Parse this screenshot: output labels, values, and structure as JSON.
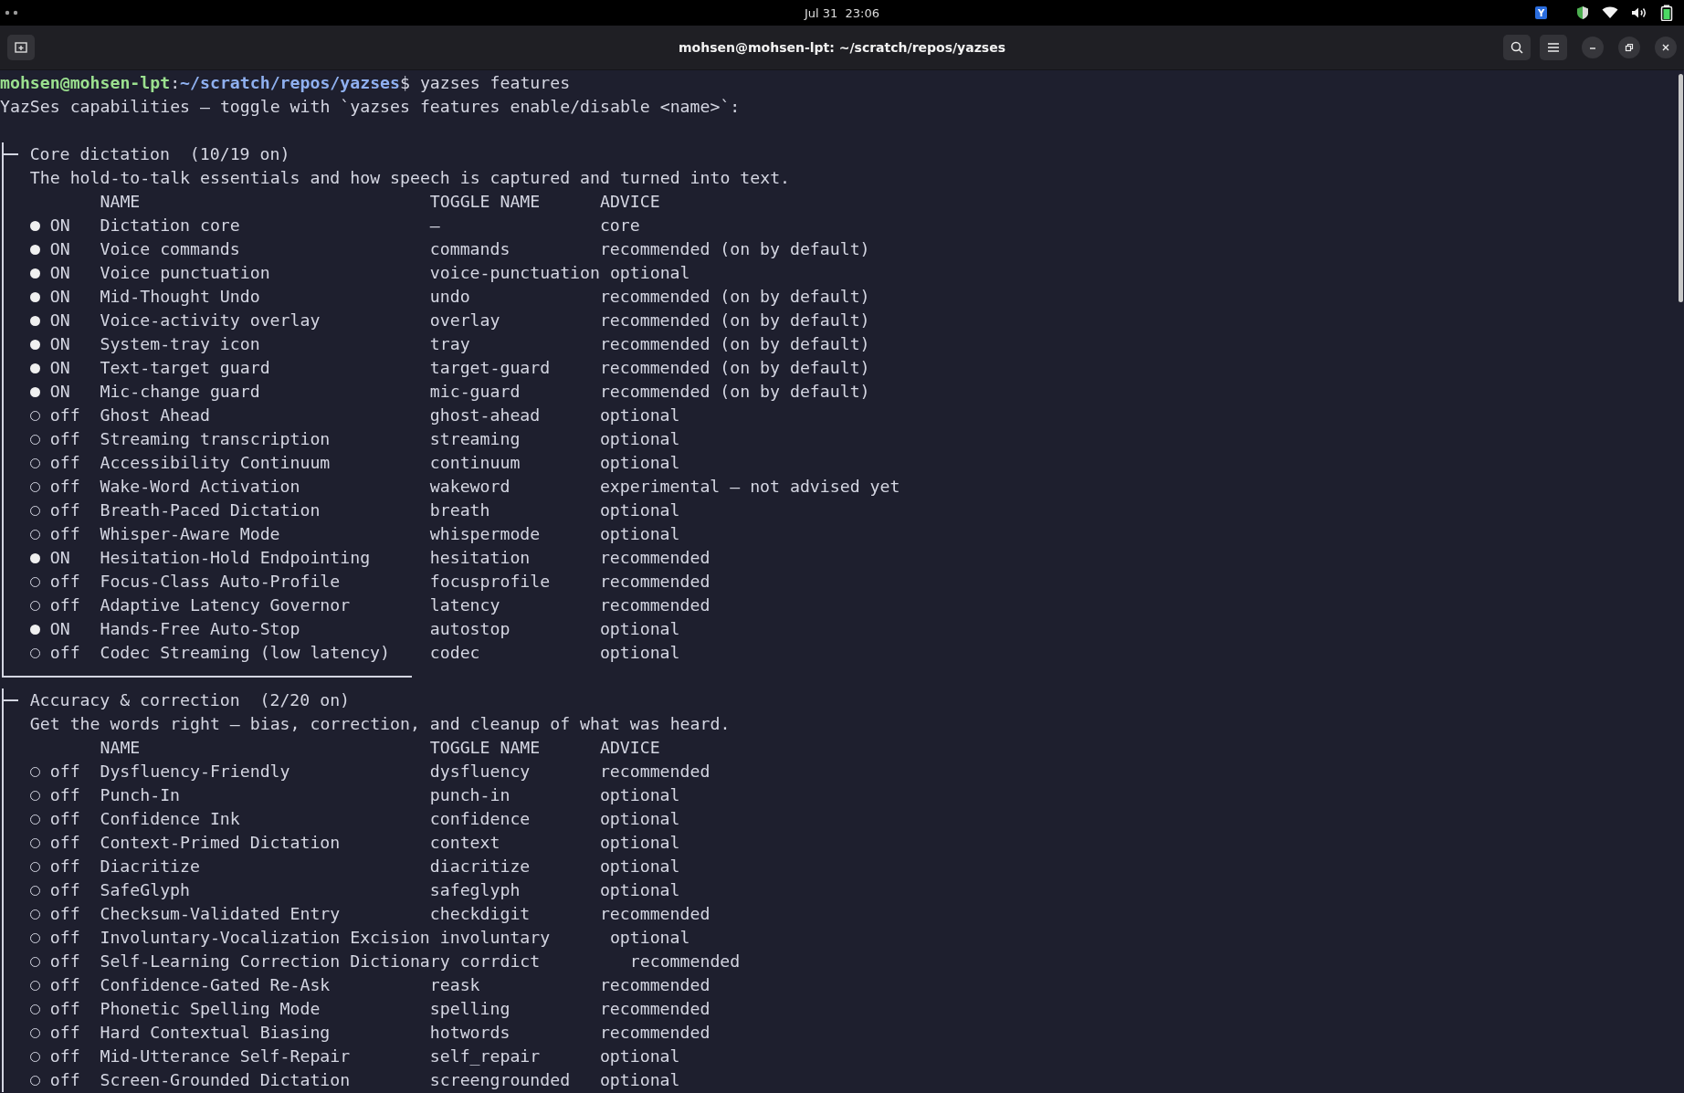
{
  "topbar": {
    "clock": "Jul 31  23:06",
    "tray_app_label": "Y"
  },
  "window": {
    "title": "mohsen@mohsen-lpt: ~/scratch/repos/yazses"
  },
  "terminal": {
    "prompt": {
      "user_host": "mohsen@mohsen-lpt",
      "separator": ":",
      "path": "~/scratch/repos/yazses",
      "symbol": "$",
      "command": "yazses features"
    },
    "intro": "YazSes capabilities — toggle with `yazses features enable/disable <name>`:",
    "sections": [
      {
        "title": "Core dictation  (10/19 on)",
        "description": "The hold-to-talk essentials and how speech is captured and turned into text.",
        "closed": true,
        "columns": [
          "NAME",
          "TOGGLE NAME",
          "ADVICE"
        ],
        "rows": [
          {
            "on": true,
            "state": "ON",
            "name": "Dictation core",
            "toggle": "—",
            "advice": "core"
          },
          {
            "on": true,
            "state": "ON",
            "name": "Voice commands",
            "toggle": "commands",
            "advice": "recommended (on by default)"
          },
          {
            "on": true,
            "state": "ON",
            "name": "Voice punctuation",
            "toggle": "voice-punctuation",
            "advice": "optional"
          },
          {
            "on": true,
            "state": "ON",
            "name": "Mid-Thought Undo",
            "toggle": "undo",
            "advice": "recommended (on by default)"
          },
          {
            "on": true,
            "state": "ON",
            "name": "Voice-activity overlay",
            "toggle": "overlay",
            "advice": "recommended (on by default)"
          },
          {
            "on": true,
            "state": "ON",
            "name": "System-tray icon",
            "toggle": "tray",
            "advice": "recommended (on by default)"
          },
          {
            "on": true,
            "state": "ON",
            "name": "Text-target guard",
            "toggle": "target-guard",
            "advice": "recommended (on by default)"
          },
          {
            "on": true,
            "state": "ON",
            "name": "Mic-change guard",
            "toggle": "mic-guard",
            "advice": "recommended (on by default)"
          },
          {
            "on": false,
            "state": "off",
            "name": "Ghost Ahead",
            "toggle": "ghost-ahead",
            "advice": "optional"
          },
          {
            "on": false,
            "state": "off",
            "name": "Streaming transcription",
            "toggle": "streaming",
            "advice": "optional"
          },
          {
            "on": false,
            "state": "off",
            "name": "Accessibility Continuum",
            "toggle": "continuum",
            "advice": "optional"
          },
          {
            "on": false,
            "state": "off",
            "name": "Wake-Word Activation",
            "toggle": "wakeword",
            "advice": "experimental — not advised yet"
          },
          {
            "on": false,
            "state": "off",
            "name": "Breath-Paced Dictation",
            "toggle": "breath",
            "advice": "optional"
          },
          {
            "on": false,
            "state": "off",
            "name": "Whisper-Aware Mode",
            "toggle": "whispermode",
            "advice": "optional"
          },
          {
            "on": true,
            "state": "ON",
            "name": "Hesitation-Hold Endpointing",
            "toggle": "hesitation",
            "advice": "recommended"
          },
          {
            "on": false,
            "state": "off",
            "name": "Focus-Class Auto-Profile",
            "toggle": "focusprofile",
            "advice": "recommended"
          },
          {
            "on": false,
            "state": "off",
            "name": "Adaptive Latency Governor",
            "toggle": "latency",
            "advice": "recommended"
          },
          {
            "on": true,
            "state": "ON",
            "name": "Hands-Free Auto-Stop",
            "toggle": "autostop",
            "advice": "optional"
          },
          {
            "on": false,
            "state": "off",
            "name": "Codec Streaming (low latency)",
            "toggle": "codec",
            "advice": "optional"
          }
        ]
      },
      {
        "title": "Accuracy & correction  (2/20 on)",
        "description": "Get the words right — bias, correction, and cleanup of what was heard.",
        "closed": false,
        "columns": [
          "NAME",
          "TOGGLE NAME",
          "ADVICE"
        ],
        "rows": [
          {
            "on": false,
            "state": "off",
            "name": "Dysfluency-Friendly",
            "toggle": "dysfluency",
            "advice": "recommended"
          },
          {
            "on": false,
            "state": "off",
            "name": "Punch-In",
            "toggle": "punch-in",
            "advice": "optional"
          },
          {
            "on": false,
            "state": "off",
            "name": "Confidence Ink",
            "toggle": "confidence",
            "advice": "optional"
          },
          {
            "on": false,
            "state": "off",
            "name": "Context-Primed Dictation",
            "toggle": "context",
            "advice": "optional"
          },
          {
            "on": false,
            "state": "off",
            "name": "Diacritize",
            "toggle": "diacritize",
            "advice": "optional"
          },
          {
            "on": false,
            "state": "off",
            "name": "SafeGlyph",
            "toggle": "safeglyph",
            "advice": "optional"
          },
          {
            "on": false,
            "state": "off",
            "name": "Checksum-Validated Entry",
            "toggle": "checkdigit",
            "advice": "recommended"
          },
          {
            "on": false,
            "state": "off",
            "name": "Involuntary-Vocalization Excision",
            "toggle": "involuntary",
            "advice": "optional"
          },
          {
            "on": false,
            "state": "off",
            "name": "Self-Learning Correction Dictionary",
            "toggle": "corrdict",
            "advice": "recommended"
          },
          {
            "on": false,
            "state": "off",
            "name": "Confidence-Gated Re-Ask",
            "toggle": "reask",
            "advice": "recommended"
          },
          {
            "on": false,
            "state": "off",
            "name": "Phonetic Spelling Mode",
            "toggle": "spelling",
            "advice": "recommended"
          },
          {
            "on": false,
            "state": "off",
            "name": "Hard Contextual Biasing",
            "toggle": "hotwords",
            "advice": "recommended"
          },
          {
            "on": false,
            "state": "off",
            "name": "Mid-Utterance Self-Repair",
            "toggle": "self_repair",
            "advice": "optional"
          },
          {
            "on": false,
            "state": "off",
            "name": "Screen-Grounded Dictation",
            "toggle": "screengrounded",
            "advice": "optional"
          }
        ]
      }
    ]
  }
}
